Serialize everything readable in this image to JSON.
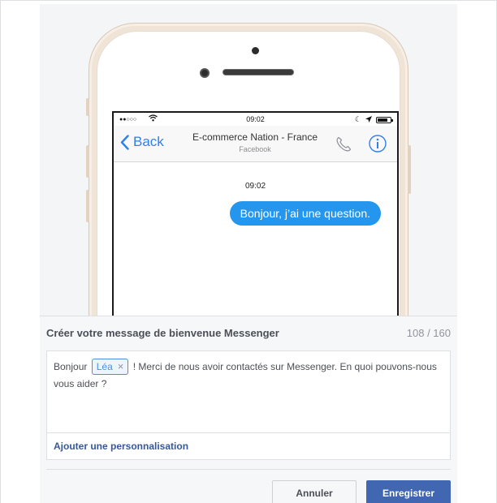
{
  "phone": {
    "status_time": "09:02",
    "back_label": "Back",
    "contact_name": "E-commerce Nation - France",
    "contact_sub": "Facebook",
    "conversation_time": "09:02",
    "message": "Bonjour, j’ai une question.",
    "icons": [
      "signal-icon",
      "wifi-icon",
      "moon-icon",
      "location-arrow-icon",
      "battery-icon",
      "back-chevron-icon",
      "phone-call-icon",
      "info-icon"
    ]
  },
  "editor": {
    "title": "Créer votre message de bienvenue Messenger",
    "char_count": "108 / 160",
    "text_before": "Bonjour",
    "token_label": "Léa",
    "token_remove": "×",
    "text_after": "! Merci de nous avoir contactés sur Messenger. En quoi pouvons-nous vous aider ?",
    "add_personalization": "Ajouter une personnalisation"
  },
  "actions": {
    "cancel_label": "Annuler",
    "save_label": "Enregistrer"
  },
  "colors": {
    "bubble": "#2596ee",
    "primary_button": "#4267b2",
    "link": "#365899",
    "token_border": "#4a90e2"
  }
}
